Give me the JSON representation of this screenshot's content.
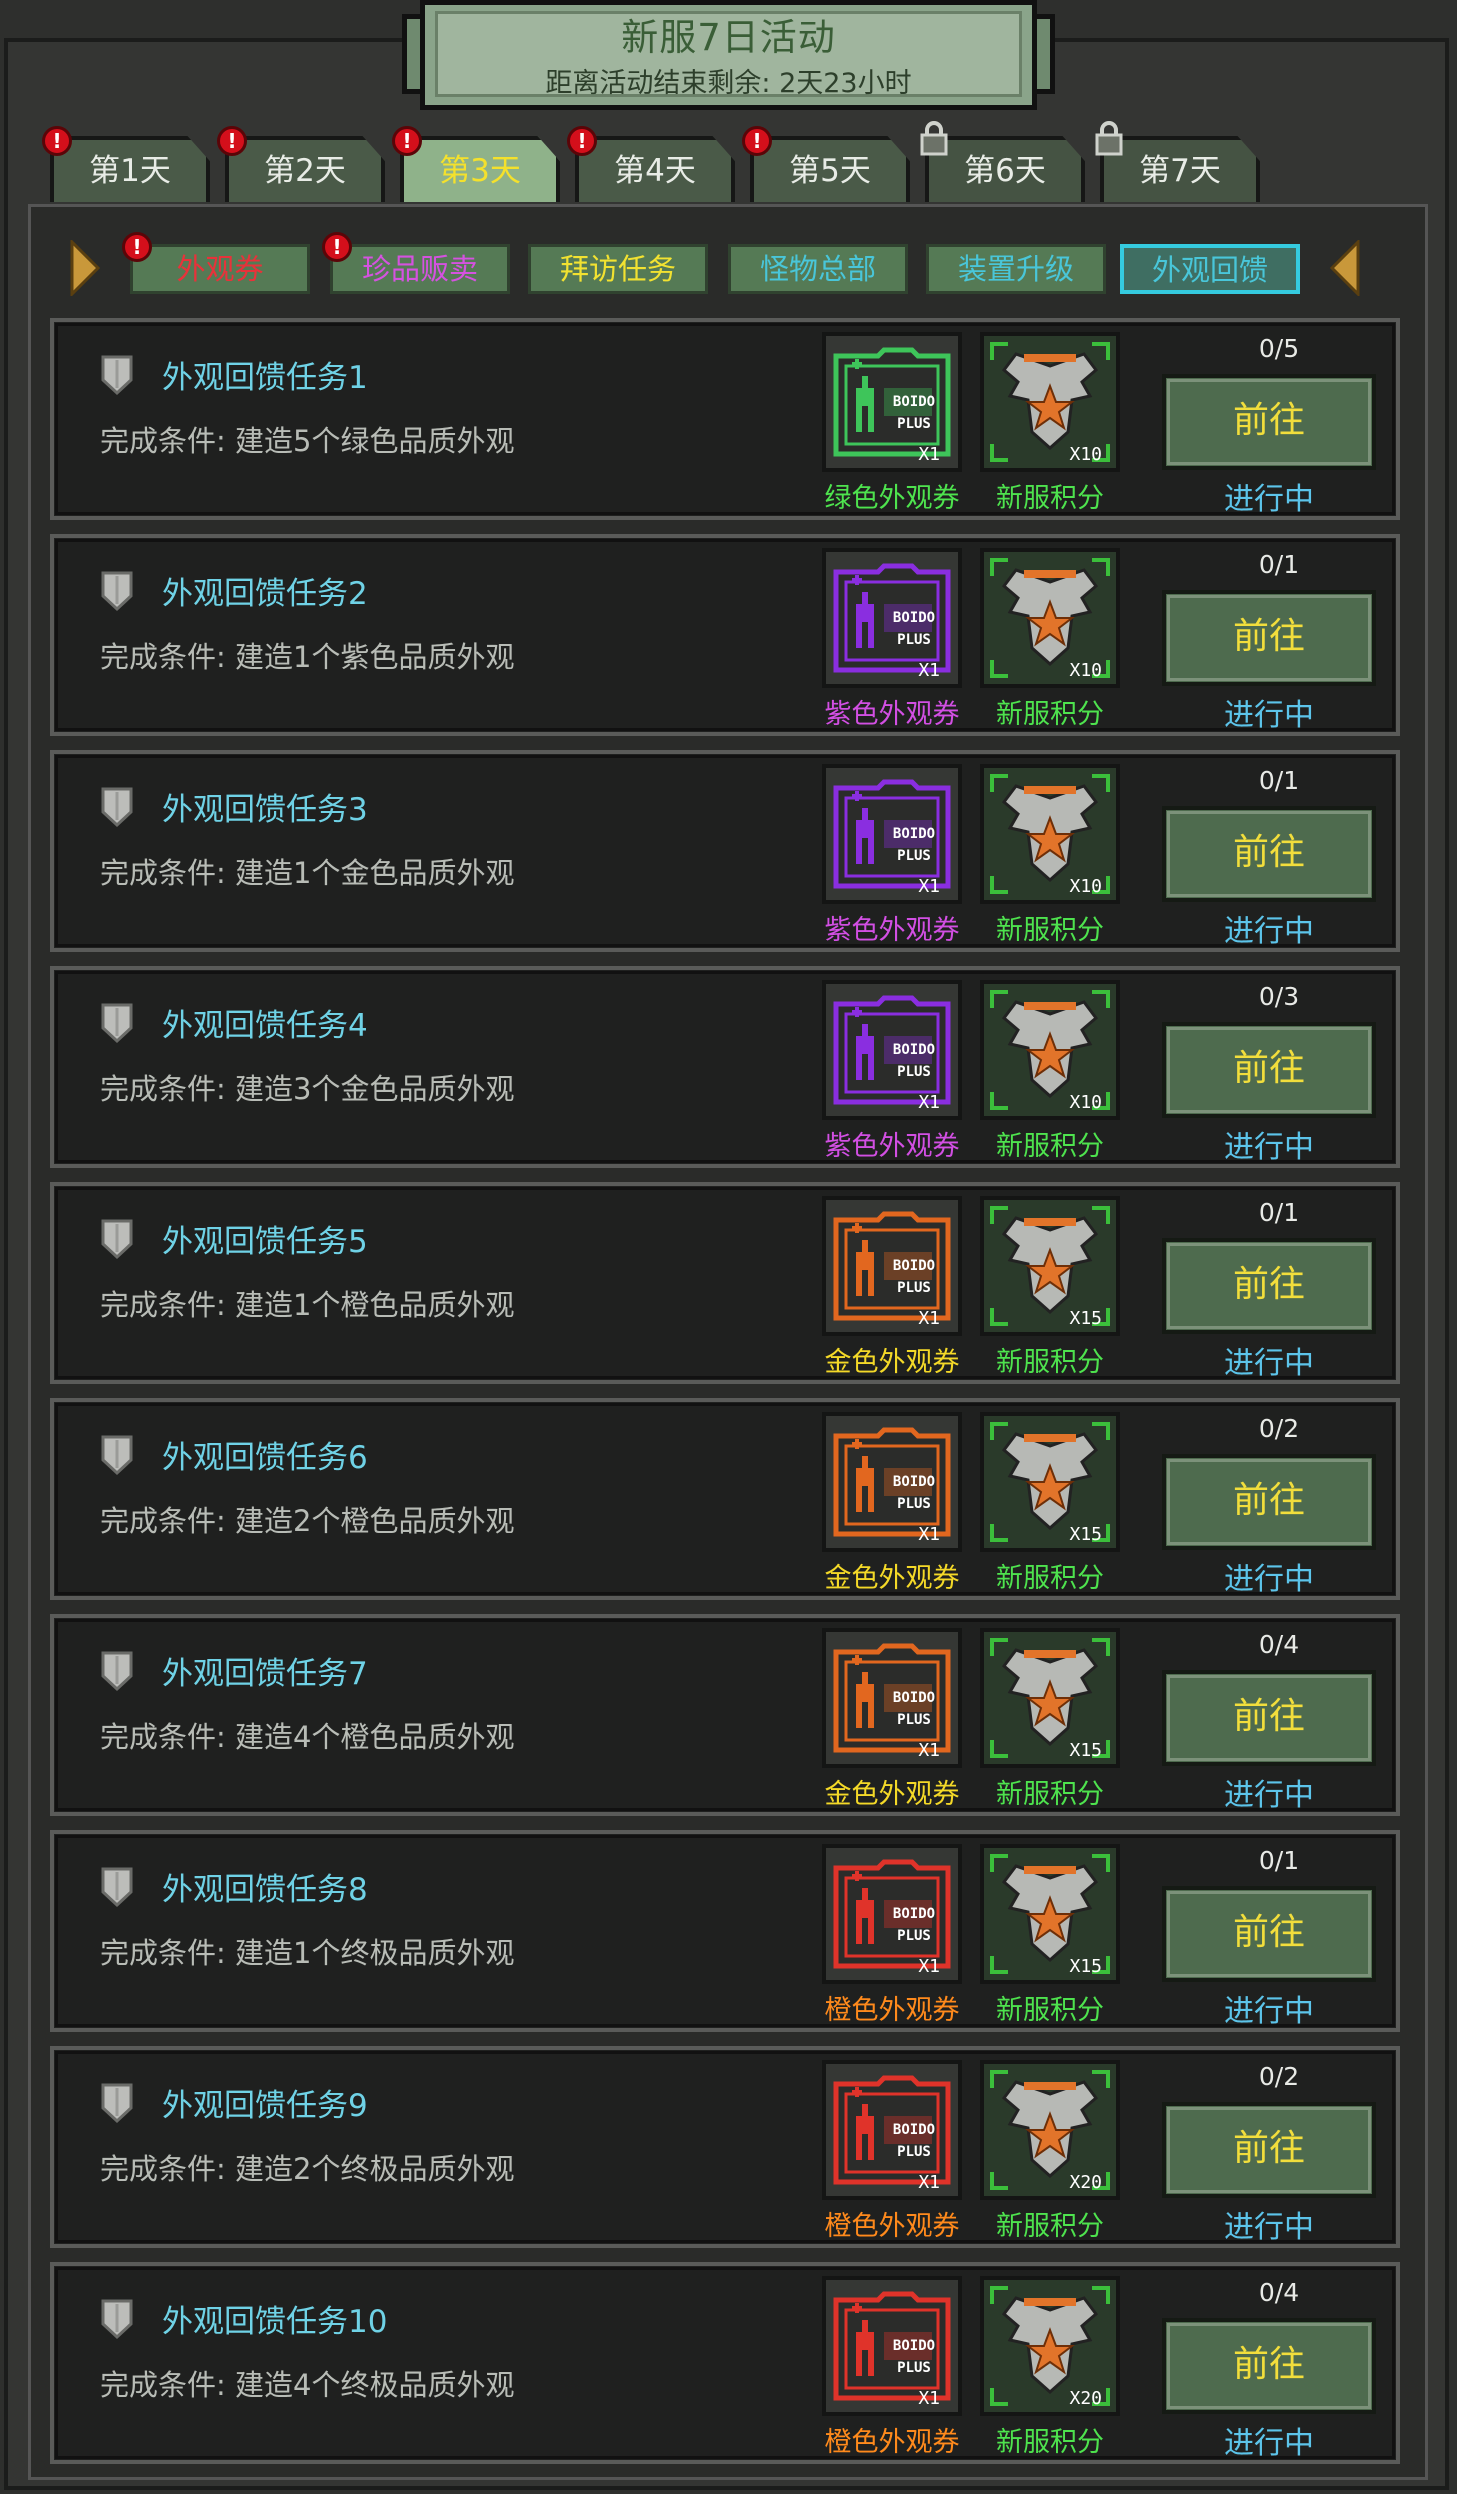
{
  "header": {
    "title": "新服7日活动",
    "countdown": "距离活动结束剩余: 2天23小时"
  },
  "day_tabs": [
    {
      "label": "第1天",
      "state": "normal",
      "alert": true
    },
    {
      "label": "第2天",
      "state": "normal",
      "alert": true
    },
    {
      "label": "第3天",
      "state": "active",
      "alert": true
    },
    {
      "label": "第4天",
      "state": "normal",
      "alert": true
    },
    {
      "label": "第5天",
      "state": "normal",
      "alert": true
    },
    {
      "label": "第6天",
      "state": "locked",
      "alert": false
    },
    {
      "label": "第7天",
      "state": "locked",
      "alert": false
    }
  ],
  "category_tabs": [
    {
      "label": "外观券",
      "color": "#e8323a",
      "alert": true,
      "selected": false
    },
    {
      "label": "珍品贩卖",
      "color": "#d552e0",
      "alert": true,
      "selected": false
    },
    {
      "label": "拜访任务",
      "color": "#f2e231",
      "alert": false,
      "selected": false
    },
    {
      "label": "怪物总部",
      "color": "#49c6d9",
      "alert": false,
      "selected": false
    },
    {
      "label": "装置升级",
      "color": "#49c6d9",
      "alert": false,
      "selected": false
    },
    {
      "label": "外观回馈",
      "color": "#49c6d9",
      "alert": false,
      "selected": true
    }
  ],
  "colors": {
    "green_ticket": "#3ec55a",
    "purple_ticket": "#8a2ee0",
    "orange_ticket": "#e2671f",
    "red_ticket": "#e0332a",
    "green_label": "#4ee34e",
    "purple_label": "#d24fe3",
    "gold_label": "#f4d928",
    "orange_label": "#ff8a1c",
    "points_label": "#4ee34e",
    "status_blue": "#5cc4ea"
  },
  "tasks": [
    {
      "name": "外观回馈任务1",
      "condition": "完成条件: 建造5个绿色品质外观",
      "progress": "0/5",
      "button": "前往",
      "status": "进行中",
      "ticket": {
        "label": "绿色外观券",
        "count": "X1",
        "tier": "green"
      },
      "points": {
        "label": "新服积分",
        "count": "X10"
      }
    },
    {
      "name": "外观回馈任务2",
      "condition": "完成条件: 建造1个紫色品质外观",
      "progress": "0/1",
      "button": "前往",
      "status": "进行中",
      "ticket": {
        "label": "紫色外观券",
        "count": "X1",
        "tier": "purple"
      },
      "points": {
        "label": "新服积分",
        "count": "X10"
      }
    },
    {
      "name": "外观回馈任务3",
      "condition": "完成条件: 建造1个金色品质外观",
      "progress": "0/1",
      "button": "前往",
      "status": "进行中",
      "ticket": {
        "label": "紫色外观券",
        "count": "X1",
        "tier": "purple"
      },
      "points": {
        "label": "新服积分",
        "count": "X10"
      }
    },
    {
      "name": "外观回馈任务4",
      "condition": "完成条件: 建造3个金色品质外观",
      "progress": "0/3",
      "button": "前往",
      "status": "进行中",
      "ticket": {
        "label": "紫色外观券",
        "count": "X1",
        "tier": "purple"
      },
      "points": {
        "label": "新服积分",
        "count": "X10"
      }
    },
    {
      "name": "外观回馈任务5",
      "condition": "完成条件: 建造1个橙色品质外观",
      "progress": "0/1",
      "button": "前往",
      "status": "进行中",
      "ticket": {
        "label": "金色外观券",
        "count": "X1",
        "tier": "gold"
      },
      "points": {
        "label": "新服积分",
        "count": "X15"
      }
    },
    {
      "name": "外观回馈任务6",
      "condition": "完成条件: 建造2个橙色品质外观",
      "progress": "0/2",
      "button": "前往",
      "status": "进行中",
      "ticket": {
        "label": "金色外观券",
        "count": "X1",
        "tier": "gold"
      },
      "points": {
        "label": "新服积分",
        "count": "X15"
      }
    },
    {
      "name": "外观回馈任务7",
      "condition": "完成条件: 建造4个橙色品质外观",
      "progress": "0/4",
      "button": "前往",
      "status": "进行中",
      "ticket": {
        "label": "金色外观券",
        "count": "X1",
        "tier": "gold"
      },
      "points": {
        "label": "新服积分",
        "count": "X15"
      }
    },
    {
      "name": "外观回馈任务8",
      "condition": "完成条件: 建造1个终极品质外观",
      "progress": "0/1",
      "button": "前往",
      "status": "进行中",
      "ticket": {
        "label": "橙色外观券",
        "count": "X1",
        "tier": "orange"
      },
      "points": {
        "label": "新服积分",
        "count": "X15"
      }
    },
    {
      "name": "外观回馈任务9",
      "condition": "完成条件: 建造2个终极品质外观",
      "progress": "0/2",
      "button": "前往",
      "status": "进行中",
      "ticket": {
        "label": "橙色外观券",
        "count": "X1",
        "tier": "orange"
      },
      "points": {
        "label": "新服积分",
        "count": "X20"
      }
    },
    {
      "name": "外观回馈任务10",
      "condition": "完成条件: 建造4个终极品质外观",
      "progress": "0/4",
      "button": "前往",
      "status": "进行中",
      "ticket": {
        "label": "橙色外观券",
        "count": "X1",
        "tier": "orange"
      },
      "points": {
        "label": "新服积分",
        "count": "X20"
      }
    }
  ],
  "icons": {
    "task_icon": "shield-icon",
    "ticket_icon": "appearance-ticket-icon",
    "points_icon": "eagle-emblem-icon",
    "locked_tab_icon": "lock-icon",
    "alert_icon": "exclamation-badge-icon",
    "nav_left": "triangle-right-icon",
    "nav_right": "triangle-left-icon"
  },
  "ticket_text": {
    "brand": "BOIDO",
    "plus": "PLUS"
  }
}
